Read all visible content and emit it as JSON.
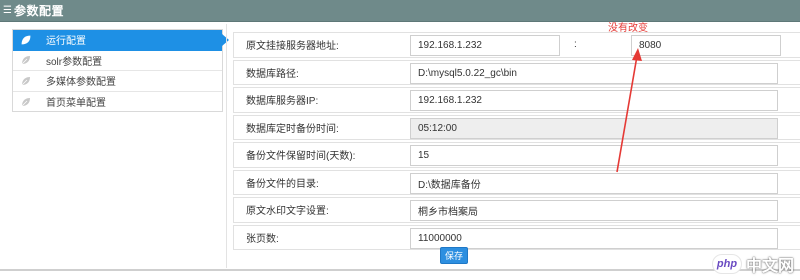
{
  "header": {
    "title": "参数配置",
    "menu_icon": "list-icon"
  },
  "sidebar": {
    "items": [
      {
        "label": "运行配置",
        "active": true
      },
      {
        "label": "solr参数配置",
        "active": false
      },
      {
        "label": "多媒体参数配置",
        "active": false
      },
      {
        "label": "首页菜单配置",
        "active": false
      }
    ]
  },
  "form": {
    "fields": [
      {
        "label": "原文挂接服务器地址:",
        "value": "192.168.1.232",
        "port": "8080",
        "separator": ":"
      },
      {
        "label": "数据库路径:",
        "value": "D:\\mysql5.0.22_gc\\bin"
      },
      {
        "label": "数据库服务器IP:",
        "value": "192.168.1.232"
      },
      {
        "label": "数据库定时备份时间:",
        "value": "05:12:00",
        "readonly": true
      },
      {
        "label": "备份文件保留时间(天数):",
        "value": "15"
      },
      {
        "label": "备份文件的目录:",
        "value": "D:\\数据库备份"
      },
      {
        "label": "原文水印文字设置:",
        "value": "桐乡市档案局"
      },
      {
        "label": "张页数:",
        "value": "11000000"
      }
    ],
    "save_label": "保存"
  },
  "annotation": {
    "text": "没有改变",
    "color": "#e53935"
  },
  "watermark": {
    "badge": "php",
    "text": "中文网"
  },
  "colors": {
    "accent": "#1e90e5",
    "titlebar": "#6f8a8a",
    "annotation": "#e53935"
  }
}
